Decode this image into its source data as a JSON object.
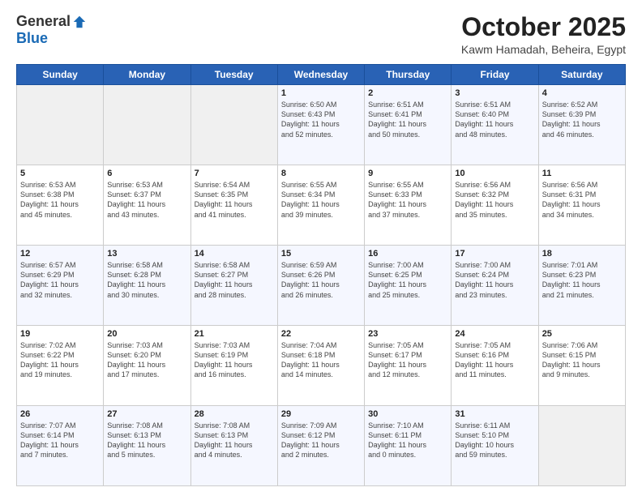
{
  "header": {
    "logo_general": "General",
    "logo_blue": "Blue",
    "month_title": "October 2025",
    "location": "Kawm Hamadah, Beheira, Egypt"
  },
  "days_of_week": [
    "Sunday",
    "Monday",
    "Tuesday",
    "Wednesday",
    "Thursday",
    "Friday",
    "Saturday"
  ],
  "weeks": [
    [
      {
        "day": "",
        "info": ""
      },
      {
        "day": "",
        "info": ""
      },
      {
        "day": "",
        "info": ""
      },
      {
        "day": "1",
        "info": "Sunrise: 6:50 AM\nSunset: 6:43 PM\nDaylight: 11 hours\nand 52 minutes."
      },
      {
        "day": "2",
        "info": "Sunrise: 6:51 AM\nSunset: 6:41 PM\nDaylight: 11 hours\nand 50 minutes."
      },
      {
        "day": "3",
        "info": "Sunrise: 6:51 AM\nSunset: 6:40 PM\nDaylight: 11 hours\nand 48 minutes."
      },
      {
        "day": "4",
        "info": "Sunrise: 6:52 AM\nSunset: 6:39 PM\nDaylight: 11 hours\nand 46 minutes."
      }
    ],
    [
      {
        "day": "5",
        "info": "Sunrise: 6:53 AM\nSunset: 6:38 PM\nDaylight: 11 hours\nand 45 minutes."
      },
      {
        "day": "6",
        "info": "Sunrise: 6:53 AM\nSunset: 6:37 PM\nDaylight: 11 hours\nand 43 minutes."
      },
      {
        "day": "7",
        "info": "Sunrise: 6:54 AM\nSunset: 6:35 PM\nDaylight: 11 hours\nand 41 minutes."
      },
      {
        "day": "8",
        "info": "Sunrise: 6:55 AM\nSunset: 6:34 PM\nDaylight: 11 hours\nand 39 minutes."
      },
      {
        "day": "9",
        "info": "Sunrise: 6:55 AM\nSunset: 6:33 PM\nDaylight: 11 hours\nand 37 minutes."
      },
      {
        "day": "10",
        "info": "Sunrise: 6:56 AM\nSunset: 6:32 PM\nDaylight: 11 hours\nand 35 minutes."
      },
      {
        "day": "11",
        "info": "Sunrise: 6:56 AM\nSunset: 6:31 PM\nDaylight: 11 hours\nand 34 minutes."
      }
    ],
    [
      {
        "day": "12",
        "info": "Sunrise: 6:57 AM\nSunset: 6:29 PM\nDaylight: 11 hours\nand 32 minutes."
      },
      {
        "day": "13",
        "info": "Sunrise: 6:58 AM\nSunset: 6:28 PM\nDaylight: 11 hours\nand 30 minutes."
      },
      {
        "day": "14",
        "info": "Sunrise: 6:58 AM\nSunset: 6:27 PM\nDaylight: 11 hours\nand 28 minutes."
      },
      {
        "day": "15",
        "info": "Sunrise: 6:59 AM\nSunset: 6:26 PM\nDaylight: 11 hours\nand 26 minutes."
      },
      {
        "day": "16",
        "info": "Sunrise: 7:00 AM\nSunset: 6:25 PM\nDaylight: 11 hours\nand 25 minutes."
      },
      {
        "day": "17",
        "info": "Sunrise: 7:00 AM\nSunset: 6:24 PM\nDaylight: 11 hours\nand 23 minutes."
      },
      {
        "day": "18",
        "info": "Sunrise: 7:01 AM\nSunset: 6:23 PM\nDaylight: 11 hours\nand 21 minutes."
      }
    ],
    [
      {
        "day": "19",
        "info": "Sunrise: 7:02 AM\nSunset: 6:22 PM\nDaylight: 11 hours\nand 19 minutes."
      },
      {
        "day": "20",
        "info": "Sunrise: 7:03 AM\nSunset: 6:20 PM\nDaylight: 11 hours\nand 17 minutes."
      },
      {
        "day": "21",
        "info": "Sunrise: 7:03 AM\nSunset: 6:19 PM\nDaylight: 11 hours\nand 16 minutes."
      },
      {
        "day": "22",
        "info": "Sunrise: 7:04 AM\nSunset: 6:18 PM\nDaylight: 11 hours\nand 14 minutes."
      },
      {
        "day": "23",
        "info": "Sunrise: 7:05 AM\nSunset: 6:17 PM\nDaylight: 11 hours\nand 12 minutes."
      },
      {
        "day": "24",
        "info": "Sunrise: 7:05 AM\nSunset: 6:16 PM\nDaylight: 11 hours\nand 11 minutes."
      },
      {
        "day": "25",
        "info": "Sunrise: 7:06 AM\nSunset: 6:15 PM\nDaylight: 11 hours\nand 9 minutes."
      }
    ],
    [
      {
        "day": "26",
        "info": "Sunrise: 7:07 AM\nSunset: 6:14 PM\nDaylight: 11 hours\nand 7 minutes."
      },
      {
        "day": "27",
        "info": "Sunrise: 7:08 AM\nSunset: 6:13 PM\nDaylight: 11 hours\nand 5 minutes."
      },
      {
        "day": "28",
        "info": "Sunrise: 7:08 AM\nSunset: 6:13 PM\nDaylight: 11 hours\nand 4 minutes."
      },
      {
        "day": "29",
        "info": "Sunrise: 7:09 AM\nSunset: 6:12 PM\nDaylight: 11 hours\nand 2 minutes."
      },
      {
        "day": "30",
        "info": "Sunrise: 7:10 AM\nSunset: 6:11 PM\nDaylight: 11 hours\nand 0 minutes."
      },
      {
        "day": "31",
        "info": "Sunrise: 6:11 AM\nSunset: 5:10 PM\nDaylight: 10 hours\nand 59 minutes."
      },
      {
        "day": "",
        "info": ""
      }
    ]
  ]
}
